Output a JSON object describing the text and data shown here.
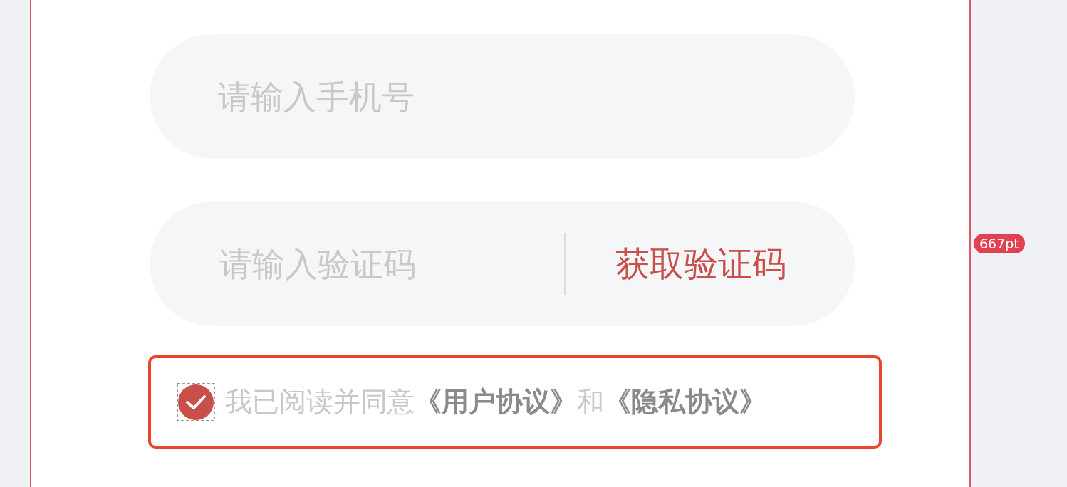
{
  "phone_field": {
    "placeholder": "请输入手机号"
  },
  "code_field": {
    "placeholder": "请输入验证码",
    "button": "获取验证码"
  },
  "agreement": {
    "checked": true,
    "highlighted": true,
    "parts": [
      {
        "kind": "text",
        "text": "我已阅读并同意"
      },
      {
        "kind": "link",
        "text": "《用户协议》"
      },
      {
        "kind": "text",
        "text": "和"
      },
      {
        "kind": "link",
        "text": "《隐私协议》"
      }
    ]
  },
  "artboard_height_badge": "667pt"
}
